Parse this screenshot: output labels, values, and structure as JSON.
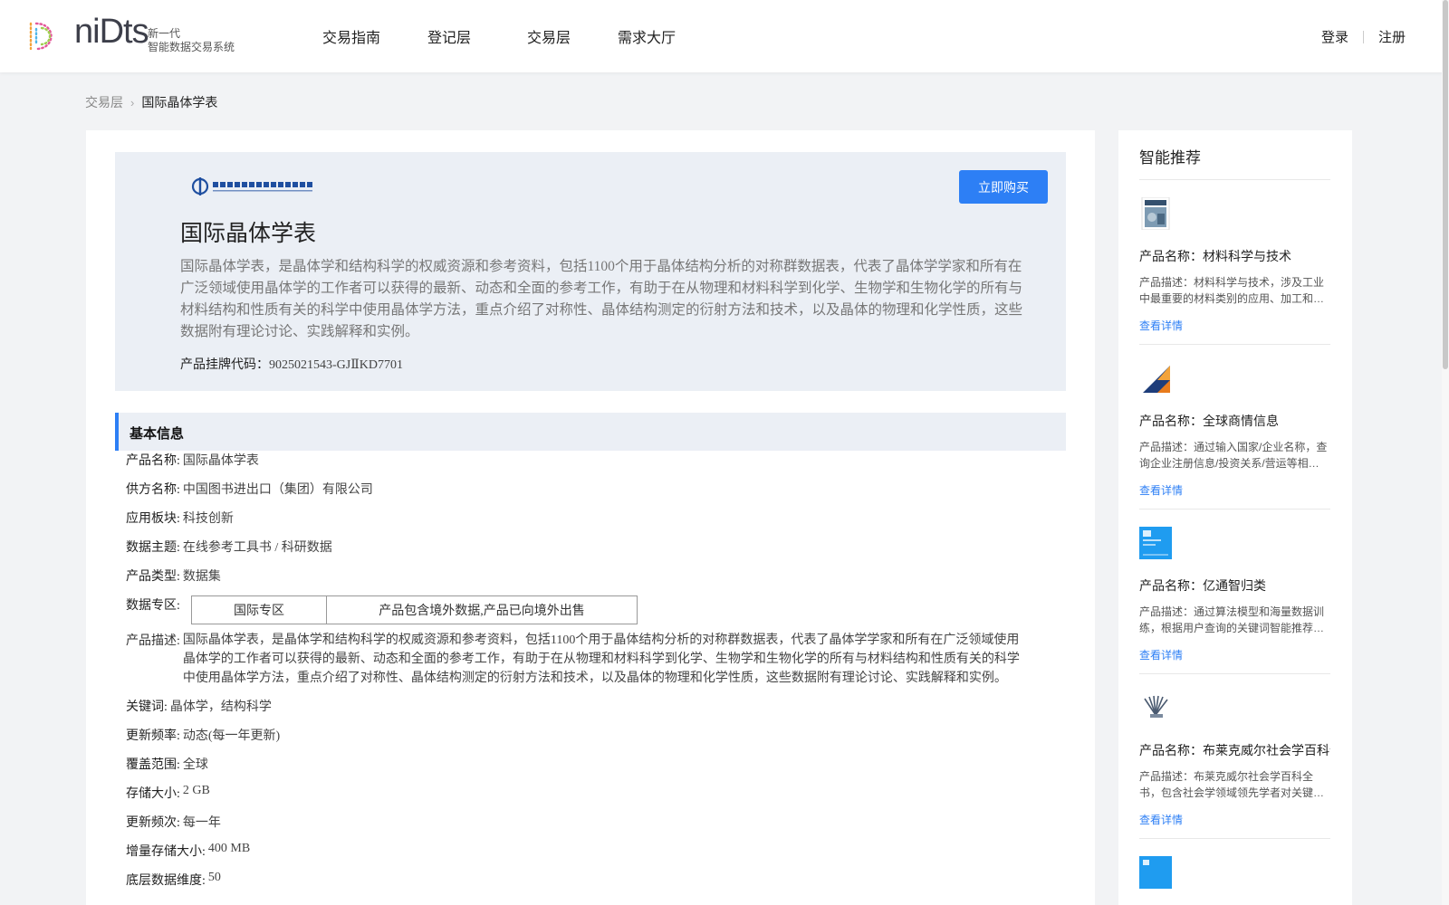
{
  "header": {
    "logo_word": "niDts",
    "logo_sub1": "新一代",
    "logo_sub2": "智能数据交易系统",
    "nav": [
      "交易指南",
      "登记层",
      "交易层",
      "需求大厅"
    ],
    "login": "登录",
    "register": "注册"
  },
  "breadcrumb": {
    "parent": "交易层",
    "current": "国际晶体学表"
  },
  "hero": {
    "buy_label": "立即购买",
    "title": "国际晶体学表",
    "description": "国际晶体学表，是晶体学和结构科学的权威资源和参考资料，包括1100个用于晶体结构分析的对称群数据表，代表了晶体学学家和所有在广泛领域使用晶体学的工作者可以获得的最新、动态和全面的参考工作，有助于在从物理和材料科学到化学、生物学和生物化学的所有与材料结构和性质有关的科学中使用晶体学方法，重点介绍了对称性、晶体结构测定的衍射方法和技术，以及晶体的物理和化学性质，这些数据附有理论讨论、实践解释和实例。",
    "code_label": "产品挂牌代码：",
    "code_value": "9025021543-GJⅡKD7701"
  },
  "basic_info": {
    "section_title": "基本信息",
    "rows": [
      {
        "label": "产品名称:",
        "value": "国际晶体学表"
      },
      {
        "label": "供方名称:",
        "value": "中国图书进出口（集团）有限公司"
      },
      {
        "label": "应用板块:",
        "value": "科技创新"
      },
      {
        "label": "数据主题:",
        "value": "在线参考工具书 / 科研数据"
      },
      {
        "label": "产品类型:",
        "value": "数据集"
      }
    ],
    "zone_label": "数据专区:",
    "zone_cells": [
      "国际专区",
      "产品包含境外数据,产品已向境外出售"
    ],
    "desc_label": "产品描述:",
    "desc_value": "国际晶体学表，是晶体学和结构科学的权威资源和参考资料，包括1100个用于晶体结构分析的对称群数据表，代表了晶体学学家和所有在广泛领域使用晶体学的工作者可以获得的最新、动态和全面的参考工作，有助于在从物理和材料科学到化学、生物学和生物化学的所有与材料结构和性质有关的科学中使用晶体学方法，重点介绍了对称性、晶体结构测定的衍射方法和技术，以及晶体的物理和化学性质，这些数据附有理论讨论、实践解释和实例。",
    "rows2": [
      {
        "label": "关键词:",
        "value": "晶体学，结构科学"
      },
      {
        "label": "更新频率:",
        "value": "动态(每一年更新)"
      },
      {
        "label": "覆盖范围:",
        "value": "全球"
      },
      {
        "label": "存储大小:",
        "value": "2 GB"
      },
      {
        "label": "更新频次:",
        "value": "每一年"
      },
      {
        "label": "增量存储大小:",
        "value": "400 MB"
      },
      {
        "label": "底层数据维度:",
        "value": "50"
      }
    ]
  },
  "side": {
    "title": "智能推荐",
    "items": [
      {
        "name": "产品名称：材料科学与技术",
        "desc": "产品描述：材料科学与技术，涉及工业中最重要的材料类别的应用、加工和…",
        "link": "查看详情"
      },
      {
        "name": "产品名称：全球商情信息",
        "desc": "产品描述：通过输入国家/企业名称，查询企业注册信息/投资关系/营运等相…",
        "link": "查看详情"
      },
      {
        "name": "产品名称：亿通智归类",
        "desc": "产品描述：通过算法模型和海量数据训练，根据用户查询的关键词智能推荐…",
        "link": "查看详情"
      },
      {
        "name": "产品名称：布莱克威尔社会学百科全书",
        "desc": "产品描述：布莱克威尔社会学百科全书，包含社会学领域领先学者对关键…",
        "link": "查看详情"
      }
    ]
  },
  "colors": {
    "accent": "#2d7ff5",
    "hero_bg": "#ebeff5",
    "page_bg": "#f2f3f5"
  }
}
